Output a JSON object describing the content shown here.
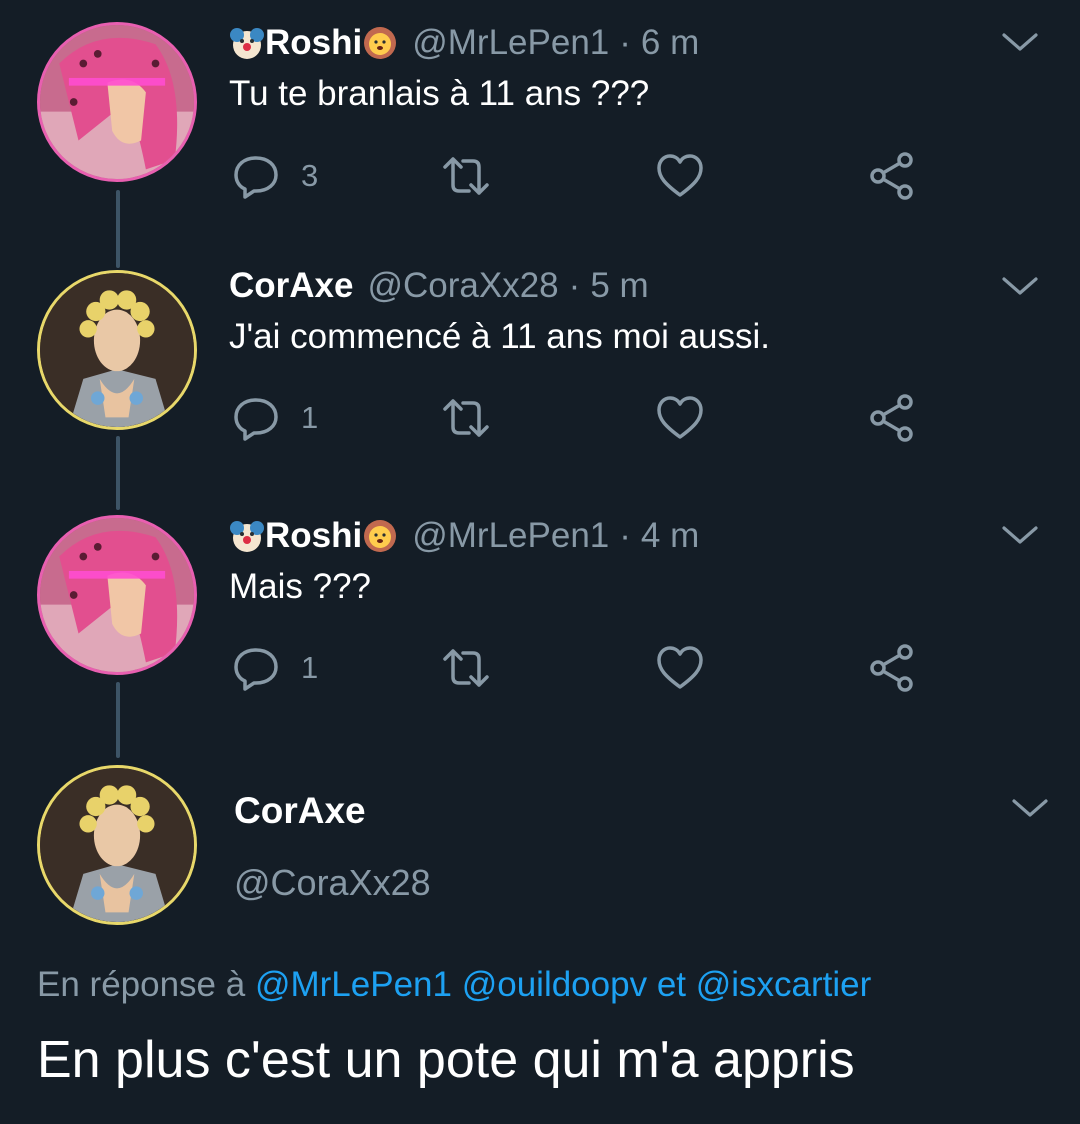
{
  "colors": {
    "background": "#141d26",
    "primary_text": "#ffffff",
    "secondary_text": "#8899a6",
    "link": "#1da1f2",
    "thread_line": "#3d5466"
  },
  "tweets": [
    {
      "name": "Roshi",
      "name_emoji_before": "clown-emoji-icon",
      "name_emoji_after": "lion-emoji-icon",
      "handle": "@MrLePen1",
      "separator": "·",
      "time": "6 m",
      "text": "Tu te branlais à 11 ans ???",
      "reply_count": "3",
      "avatar": "pink-hair-avatar"
    },
    {
      "name": "CorAxe",
      "handle": "@CoraXx28",
      "separator": "·",
      "time": "5 m",
      "text": "J'ai commencé à 11 ans moi aussi.",
      "reply_count": "1",
      "avatar": "blond-hair-avatar"
    },
    {
      "name": "Roshi",
      "name_emoji_before": "clown-emoji-icon",
      "name_emoji_after": "lion-emoji-icon",
      "handle": "@MrLePen1",
      "separator": "·",
      "time": "4 m",
      "text": "Mais ???",
      "reply_count": "1",
      "avatar": "pink-hair-avatar"
    }
  ],
  "main_tweet": {
    "name": "CorAxe",
    "handle": "@CoraXx28",
    "reply_prefix": "En réponse à",
    "mention_1": "@MrLePen1",
    "mention_2": "@ouildoopv",
    "mention_joiner": "et",
    "mention_3": "@isxcartier",
    "text": "En plus c'est un pote qui m'a appris",
    "avatar": "blond-hair-avatar"
  }
}
